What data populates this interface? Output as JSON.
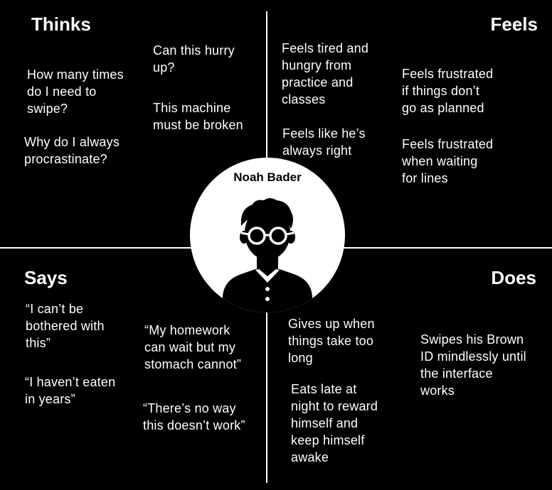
{
  "quadrants": {
    "thinks": {
      "title": "Thinks",
      "notes": [
        "How many times\ndo I need to\nswipe?",
        "Why do I always\nprocrastinate?",
        "Can this hurry\nup?",
        "This machine\nmust be broken"
      ]
    },
    "feels": {
      "title": "Feels",
      "notes": [
        "Feels tired and\nhungry from\npractice and\nclasses",
        "Feels like he’s\nalways right",
        "Feels frustrated\nif things don’t\ngo as planned",
        "Feels frustrated\nwhen waiting\nfor lines"
      ]
    },
    "says": {
      "title": "Says",
      "notes": [
        "“I can’t be\nbothered with\nthis”",
        "“I haven’t eaten\nin years”",
        "“My homework\ncan wait but my\nstomach cannot”",
        "“There’s no way\nthis doesn’t work”"
      ]
    },
    "does": {
      "title": "Does",
      "notes": [
        "Gives up when\nthings take too\nlong",
        "Eats late at\nnight to reward\nhimself and\nkeep himself\nawake",
        "Swipes his Brown\nID mindlessly until\nthe interface\nworks"
      ]
    }
  },
  "persona": {
    "name": "Noah Bader",
    "avatar_icon": "person-with-glasses-icon"
  },
  "colors": {
    "background": "#000000",
    "foreground": "#ffffff"
  }
}
